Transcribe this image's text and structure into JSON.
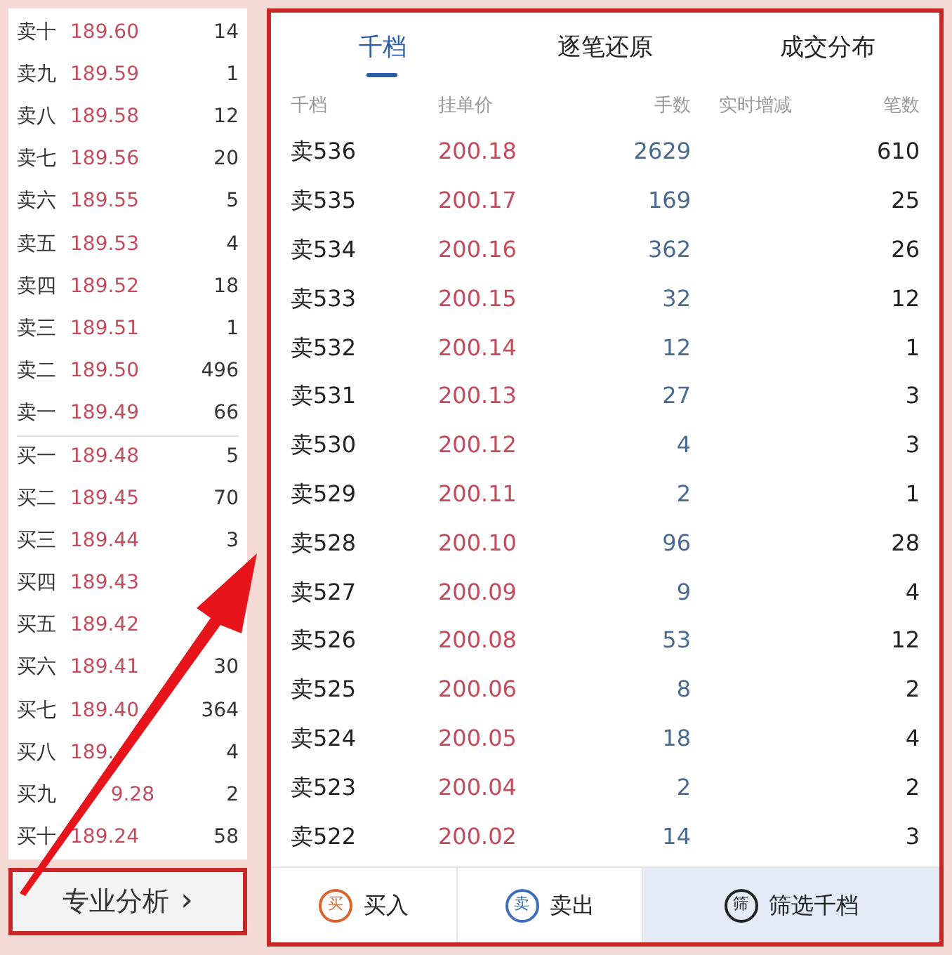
{
  "order_book": {
    "rows": [
      {
        "label": "卖十",
        "price": "189.60",
        "volume": "14"
      },
      {
        "label": "卖九",
        "price": "189.59",
        "volume": "1"
      },
      {
        "label": "卖八",
        "price": "189.58",
        "volume": "12"
      },
      {
        "label": "卖七",
        "price": "189.56",
        "volume": "20"
      },
      {
        "label": "卖六",
        "price": "189.55",
        "volume": "5"
      },
      {
        "label": "卖五",
        "price": "189.53",
        "volume": "4"
      },
      {
        "label": "卖四",
        "price": "189.52",
        "volume": "18"
      },
      {
        "label": "卖三",
        "price": "189.51",
        "volume": "1"
      },
      {
        "label": "卖二",
        "price": "189.50",
        "volume": "496"
      },
      {
        "label": "卖一",
        "price": "189.49",
        "volume": "66"
      },
      {
        "label": "买一",
        "price": "189.48",
        "volume": "5"
      },
      {
        "label": "买二",
        "price": "189.45",
        "volume": "70"
      },
      {
        "label": "买三",
        "price": "189.44",
        "volume": "3"
      },
      {
        "label": "买四",
        "price": "189.43"
      },
      {
        "label": "买五",
        "price": "189.42"
      },
      {
        "label": "买六",
        "price": "189.41",
        "volume": "30"
      },
      {
        "label": "买七",
        "price": "189.40",
        "volume": "364"
      },
      {
        "label": "买八",
        "price_head": "189.",
        "volume": "4"
      },
      {
        "label": "买九",
        "price_tail": "9.28",
        "volume": "2"
      },
      {
        "label": "买十",
        "price": "189.24",
        "volume": "58"
      }
    ],
    "analysis_button": {
      "label": "专业分析",
      "chevron": "›"
    }
  },
  "panel": {
    "tabs": [
      {
        "label": "千档",
        "selected": true
      },
      {
        "label": "逐笔还原",
        "selected": false
      },
      {
        "label": "成交分布",
        "selected": false
      }
    ],
    "table": {
      "columns": [
        "千档",
        "挂单价",
        "手数",
        "实时增减",
        "笔数"
      ],
      "rows": [
        [
          "卖536",
          "200.18",
          "2629",
          "",
          "610"
        ],
        [
          "卖535",
          "200.17",
          "169",
          "",
          "25"
        ],
        [
          "卖534",
          "200.16",
          "362",
          "",
          "26"
        ],
        [
          "卖533",
          "200.15",
          "32",
          "",
          "12"
        ],
        [
          "卖532",
          "200.14",
          "12",
          "",
          "1"
        ],
        [
          "卖531",
          "200.13",
          "27",
          "",
          "3"
        ],
        [
          "卖530",
          "200.12",
          "4",
          "",
          "3"
        ],
        [
          "卖529",
          "200.11",
          "2",
          "",
          "1"
        ],
        [
          "卖528",
          "200.10",
          "96",
          "",
          "28"
        ],
        [
          "卖527",
          "200.09",
          "9",
          "",
          "4"
        ],
        [
          "卖526",
          "200.08",
          "53",
          "",
          "12"
        ],
        [
          "卖525",
          "200.06",
          "8",
          "",
          "2"
        ],
        [
          "卖524",
          "200.05",
          "18",
          "",
          "4"
        ],
        [
          "卖523",
          "200.04",
          "2",
          "",
          "2"
        ],
        [
          "卖522",
          "200.02",
          "14",
          "",
          "3"
        ]
      ]
    },
    "actions": [
      {
        "kind": "buy",
        "icon_char": "买",
        "label": "买入"
      },
      {
        "kind": "sell",
        "icon_char": "卖",
        "label": "卖出"
      },
      {
        "kind": "filter",
        "icon_char": "筛",
        "label": "筛选千档"
      }
    ]
  }
}
